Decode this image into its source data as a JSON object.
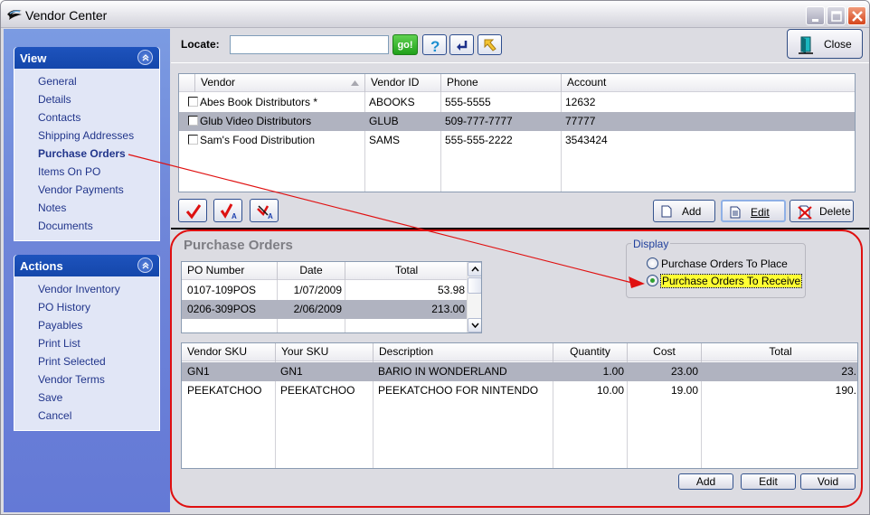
{
  "window": {
    "title": "Vendor Center"
  },
  "sidebar": {
    "view": {
      "title": "View",
      "items": [
        {
          "label": "General",
          "active": false
        },
        {
          "label": "Details",
          "active": false
        },
        {
          "label": "Contacts",
          "active": false
        },
        {
          "label": "Shipping Addresses",
          "active": false
        },
        {
          "label": "Purchase Orders",
          "active": true
        },
        {
          "label": "Items On PO",
          "active": false
        },
        {
          "label": "Vendor Payments",
          "active": false
        },
        {
          "label": "Notes",
          "active": false
        },
        {
          "label": "Documents",
          "active": false
        }
      ]
    },
    "actions": {
      "title": "Actions",
      "items": [
        {
          "label": "Vendor Inventory"
        },
        {
          "label": "PO History"
        },
        {
          "label": "Payables"
        },
        {
          "label": "Print List"
        },
        {
          "label": "Print Selected"
        },
        {
          "label": "Vendor Terms"
        },
        {
          "label": "Save"
        },
        {
          "label": "Cancel"
        }
      ]
    }
  },
  "toolbar": {
    "locate_label": "Locate:",
    "locate_value": "",
    "go_label": "go!",
    "help_icon": "question-icon",
    "back_icon": "return-arrow-icon",
    "pointer_icon": "arrow-pointer-icon",
    "close_label": "Close"
  },
  "vendors": {
    "columns": [
      "Vendor",
      "Vendor ID",
      "Phone",
      "Account"
    ],
    "sort_column": "Vendor",
    "rows": [
      {
        "vendor": "Abes Book Distributors *",
        "id": "ABOOKS",
        "phone": "555-5555",
        "account": "12632",
        "selected": false
      },
      {
        "vendor": "Glub Video Distributors",
        "id": "GLUB",
        "phone": "509-777-7777",
        "account": "77777",
        "selected": true
      },
      {
        "vendor": "Sam's Food Distribution",
        "id": "SAMS",
        "phone": "555-555-2222",
        "account": "3543424",
        "selected": false
      }
    ],
    "buttons": {
      "check_all_icon": "checkmark-icon",
      "check_a_icon": "checkmark-a-icon",
      "uncheck_a_icon": "uncheck-a-icon",
      "add": "Add",
      "edit": "Edit",
      "delete": "Delete"
    }
  },
  "purchase_orders": {
    "title": "Purchase Orders",
    "display": {
      "legend": "Display",
      "options": [
        {
          "label": "Purchase Orders To Place",
          "selected": false
        },
        {
          "label": "Purchase Orders To Receive",
          "selected": true
        }
      ]
    },
    "po_columns": [
      "PO Number",
      "Date",
      "Total"
    ],
    "po_rows": [
      {
        "number": "0107-109POS",
        "date": "1/07/2009",
        "total": "53.98",
        "selected": false
      },
      {
        "number": "0206-309POS",
        "date": "2/06/2009",
        "total": "213.00",
        "selected": true
      }
    ],
    "item_columns": [
      "Vendor SKU",
      "Your SKU",
      "Description",
      "Quantity",
      "Cost",
      "Total"
    ],
    "item_rows": [
      {
        "vendor_sku": "GN1",
        "your_sku": "GN1",
        "description": "BARIO IN WONDERLAND",
        "quantity": "1.00",
        "cost": "23.00",
        "total": "23.",
        "selected": true
      },
      {
        "vendor_sku": "PEEKATCHOO",
        "your_sku": "PEEKATCHOO",
        "description": "PEEKATCHOO FOR NINTENDO",
        "quantity": "10.00",
        "cost": "19.00",
        "total": "190.",
        "selected": false
      }
    ],
    "buttons": {
      "add": "Add",
      "edit": "Edit",
      "void": "Void"
    }
  },
  "annotation": {
    "color": "#e01010"
  }
}
